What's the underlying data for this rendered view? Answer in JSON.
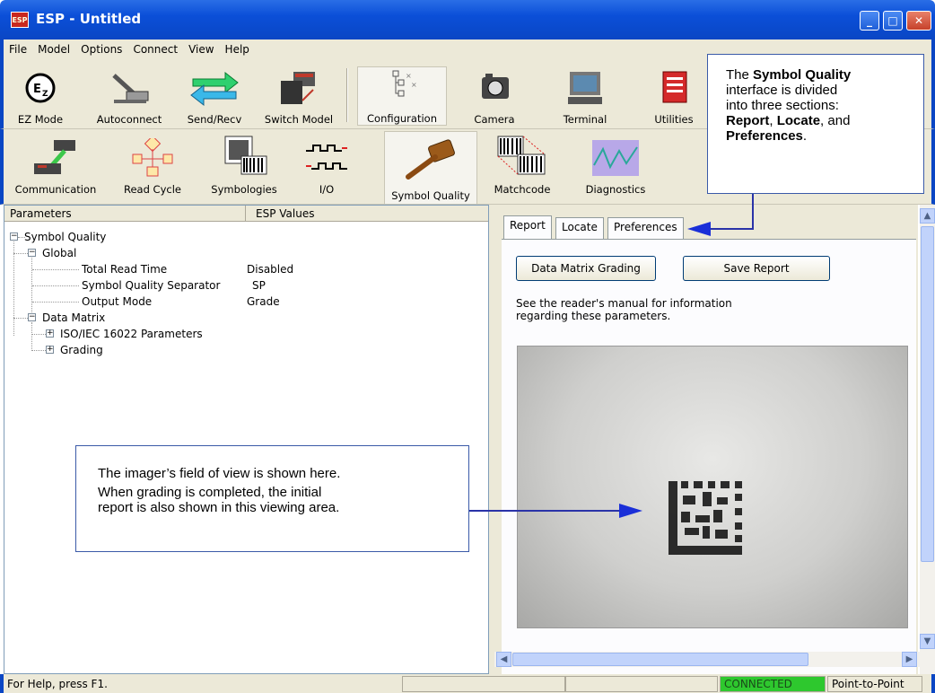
{
  "window": {
    "title": "ESP - Untitled",
    "app_icon": "ESP"
  },
  "menu": [
    "File",
    "Model",
    "Options",
    "Connect",
    "View",
    "Help"
  ],
  "toolbar1": [
    {
      "label": "EZ Mode",
      "icon": "ez-mode-icon"
    },
    {
      "label": "Autoconnect",
      "icon": "autoconnect-icon"
    },
    {
      "label": "Send/Recv",
      "icon": "send-recv-icon"
    },
    {
      "label": "Switch Model",
      "icon": "switch-model-icon"
    },
    {
      "label": "Configuration",
      "icon": "configuration-icon"
    },
    {
      "label": "Camera",
      "icon": "camera-icon"
    },
    {
      "label": "Terminal",
      "icon": "terminal-icon"
    },
    {
      "label": "Utilities",
      "icon": "utilities-icon"
    }
  ],
  "toolbar2": [
    {
      "label": "Communication",
      "icon": "communication-icon"
    },
    {
      "label": "Read Cycle",
      "icon": "read-cycle-icon"
    },
    {
      "label": "Symbologies",
      "icon": "symbologies-icon"
    },
    {
      "label": "I/O",
      "icon": "io-icon"
    },
    {
      "label": "Symbol Quality",
      "icon": "symbol-quality-icon"
    },
    {
      "label": "Matchcode",
      "icon": "matchcode-icon"
    },
    {
      "label": "Diagnostics",
      "icon": "diagnostics-icon"
    }
  ],
  "tree": {
    "col_parameters": "Parameters",
    "col_values": "ESP Values",
    "root": "Symbol Quality",
    "global": "Global",
    "rows": [
      {
        "name": "Total Read Time",
        "value": "Disabled"
      },
      {
        "name": "Symbol Quality Separator",
        "value": "SP"
      },
      {
        "name": "Output Mode",
        "value": "Grade"
      }
    ],
    "data_matrix": "Data Matrix",
    "iso": "ISO/IEC 16022 Parameters",
    "grading": "Grading"
  },
  "tabs": [
    "Report",
    "Locate",
    "Preferences"
  ],
  "buttons": {
    "grading": "Data Matrix Grading",
    "save": "Save Report"
  },
  "info": [
    "See the reader's manual for information",
    "regarding these parameters."
  ],
  "callout_top": {
    "l1a": "The ",
    "l1b": "Symbol Quality",
    "l2": "interface is divided",
    "l3": "into three sections:",
    "l4a": "Report",
    "l4b": ", ",
    "l4c": "Locate",
    "l4d": ", and",
    "l5a": "Preferences",
    "l5b": "."
  },
  "callout_mid": [
    "The imager’s field of view is shown here.",
    "When grading is completed, the initial",
    "report is also shown in this viewing area."
  ],
  "status": {
    "help": "For Help, press F1.",
    "connected": "CONNECTED",
    "mode": "Point-to-Point"
  },
  "colors": {
    "titlebar": "#0a46c4",
    "connected": "#2ec82e"
  }
}
